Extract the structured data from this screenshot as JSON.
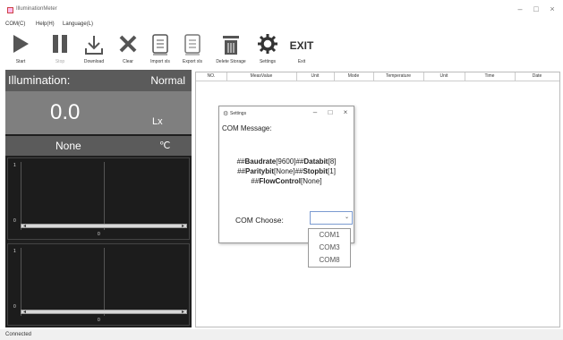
{
  "window": {
    "title": "IlluminationMeter",
    "minimize": "–",
    "maximize": "□",
    "close": "×"
  },
  "menu": [
    "COM(C)",
    "Help(H)",
    "Language(L)"
  ],
  "toolbar": [
    {
      "label": "Start",
      "icon": "play-icon"
    },
    {
      "label": "Stop",
      "icon": "pause-icon",
      "disabled": true
    },
    {
      "label": "Download",
      "icon": "download-icon"
    },
    {
      "label": "Clear",
      "icon": "clear-x-icon"
    },
    {
      "label": "Import xls",
      "icon": "import-icon"
    },
    {
      "label": "Export xls",
      "icon": "export-icon"
    },
    {
      "label": "Delete Storage",
      "icon": "trash-icon"
    },
    {
      "label": "Settings",
      "icon": "gear-icon"
    },
    {
      "label": "Exit",
      "icon_text": "EXIT"
    }
  ],
  "panel": {
    "illumination_label": "Illumination:",
    "status": "Normal",
    "value": "0.0",
    "unit": "Lx",
    "temperature_value": "None",
    "temperature_unit": "℃"
  },
  "charts": [
    {
      "y_top": "1",
      "y_bottom": "0",
      "x_label": "0"
    },
    {
      "y_top": "1",
      "y_bottom": "0",
      "x_label": "0"
    }
  ],
  "table": {
    "columns": [
      "NO.",
      "MeasValue",
      "Unit",
      "Mode",
      "Temperature",
      "Unit",
      "Time",
      "Date"
    ]
  },
  "dialog": {
    "title": "Settings",
    "com_message_label": "COM Message:",
    "params_line1": [
      "##",
      "Baudrate",
      "[9600]##",
      "Databit",
      "[8]"
    ],
    "params_line2": [
      "##",
      "Paritybit",
      "[None]##",
      "Stopbit",
      "[1]"
    ],
    "params_line3": [
      "##",
      "FlowControl",
      "[None]"
    ],
    "com_choose_label": "COM Choose:",
    "com_selected": "",
    "com_options": [
      "COM1",
      "COM3",
      "COM8"
    ]
  },
  "status_bar": "Connected",
  "colors": {
    "panel_dark": "#1f1f1f",
    "panel_gray": "#5b5b5b",
    "panel_mid": "#7f7f7f",
    "combo_border": "#7a9ad0"
  }
}
